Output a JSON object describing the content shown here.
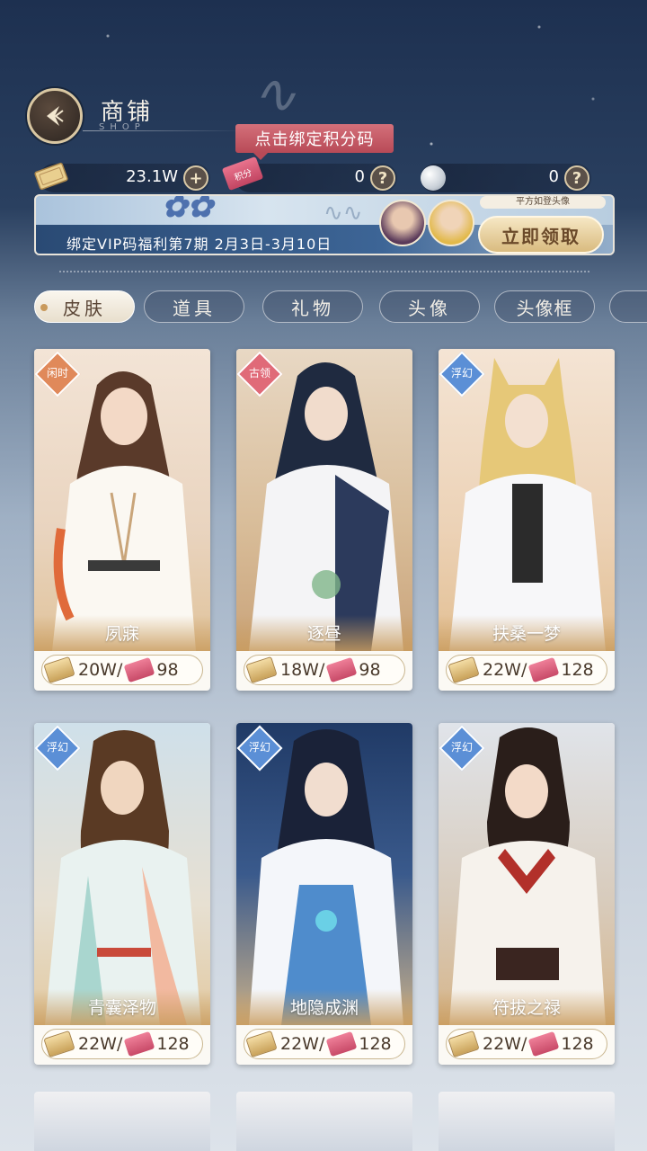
{
  "header": {
    "title": "商铺",
    "subtitle": "SHOP",
    "bind_tip": "点击绑定积分码"
  },
  "currencies": [
    {
      "name": "coin",
      "value": "23.1W",
      "button": "+"
    },
    {
      "name": "points-ticket",
      "value": "0",
      "button": "?",
      "icon_text": "积分"
    },
    {
      "name": "pearl",
      "value": "0",
      "button": "?"
    }
  ],
  "banner": {
    "text": "绑定VIP码福利第7期  2月3日-3月10日",
    "caption": "平方如登头像",
    "claim_label": "立即领取"
  },
  "tabs": [
    {
      "label": "皮肤",
      "active": true
    },
    {
      "label": "道具",
      "active": false
    },
    {
      "label": "礼物",
      "active": false
    },
    {
      "label": "头像",
      "active": false
    },
    {
      "label": "头像框",
      "active": false
    }
  ],
  "items": [
    {
      "name": "夙寐",
      "tag": "闲时",
      "tag_color": "#e0895a",
      "price_coin": "20W/",
      "price_ticket": "98"
    },
    {
      "name": "逐昼",
      "tag": "古领",
      "tag_color": "#e06a78",
      "price_coin": "18W/",
      "price_ticket": "98"
    },
    {
      "name": "扶桑一梦",
      "tag": "浮幻",
      "tag_color": "#5b8fd6",
      "price_coin": "22W/",
      "price_ticket": "128"
    },
    {
      "name": "青囊泽物",
      "tag": "浮幻",
      "tag_color": "#5b8fd6",
      "price_coin": "22W/",
      "price_ticket": "128"
    },
    {
      "name": "地隐成渊",
      "tag": "浮幻",
      "tag_color": "#5b8fd6",
      "price_coin": "22W/",
      "price_ticket": "128"
    },
    {
      "name": "符拔之禄",
      "tag": "浮幻",
      "tag_color": "#5b8fd6",
      "price_coin": "22W/",
      "price_ticket": "128"
    }
  ],
  "colors": {
    "accent_gold": "#d9bb7f",
    "tip_pink": "#b84a57",
    "tag_blue": "#5b8fd6"
  }
}
